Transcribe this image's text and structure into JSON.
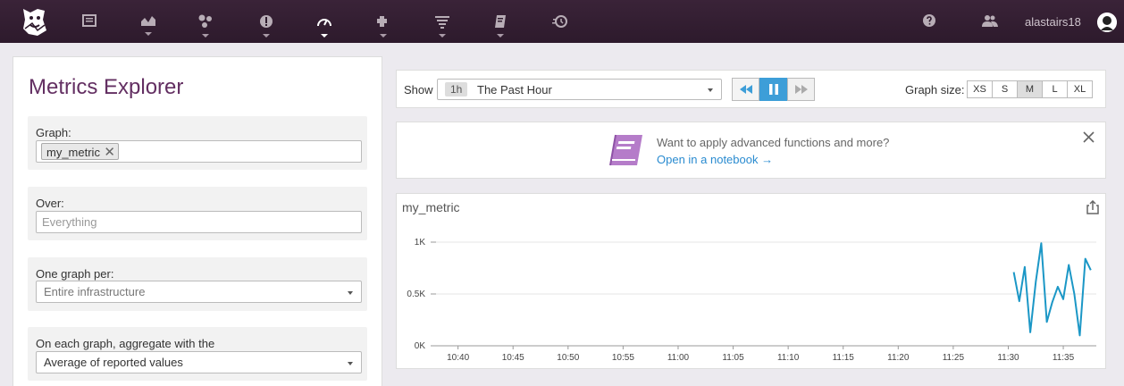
{
  "nav": {
    "icons": [
      "dashboard-icon",
      "metrics-icon",
      "integrations-icon",
      "monitors-icon",
      "apm-icon",
      "infrastructure-icon",
      "logs-icon",
      "notebooks-icon",
      "synthetics-icon"
    ],
    "help_icon": "help-icon",
    "team_icon": "team-icon",
    "username": "alastairs18"
  },
  "left": {
    "title": "Metrics Explorer",
    "graph_label": "Graph:",
    "graph_tag": "my_metric",
    "graph_tag_remove": "✕",
    "over_label": "Over:",
    "over_placeholder": "Everything",
    "per_label": "One graph per:",
    "per_value": "Entire infrastructure",
    "agg_label": "On each graph, aggregate with the",
    "agg_value": "Average of reported values"
  },
  "toolbar": {
    "show_label": "Show",
    "time_badge": "1h",
    "time_text": "The Past Hour",
    "graph_size_label": "Graph size:",
    "sizes": [
      "XS",
      "S",
      "M",
      "L",
      "XL"
    ],
    "active_size": "M"
  },
  "banner": {
    "line1": "Want to apply advanced functions and more?",
    "line2": "Open in a notebook →"
  },
  "colors": {
    "nav_bg": "#2d1a2c",
    "title": "#632f62",
    "accent": "#3d9ed8",
    "line": "#1b97c6",
    "notebook_icon": "#b57cc9"
  },
  "graph": {
    "title": "my_metric"
  },
  "chart_data": {
    "type": "line",
    "title": "my_metric",
    "xlabel": "",
    "ylabel": "",
    "ylim": [
      0,
      1000
    ],
    "yticks": [
      "0K",
      "0.5K",
      "1K"
    ],
    "ytick_values": [
      0,
      500,
      1000
    ],
    "xticks": [
      "10:40",
      "10:45",
      "10:50",
      "10:55",
      "11:00",
      "11:05",
      "11:10",
      "11:15",
      "11:20",
      "11:25",
      "11:30",
      "11:35"
    ],
    "xrange": [
      "10:38",
      "11:38"
    ],
    "grid": true,
    "series": [
      {
        "x": [
          "11:30.5",
          "11:31",
          "11:31.5",
          "11:32",
          "11:32.5",
          "11:33",
          "11:33.5",
          "11:34",
          "11:34.5",
          "11:35",
          "11:35.5",
          "11:36",
          "11:36.5",
          "11:37",
          "11:37.5"
        ],
        "values": [
          710,
          430,
          760,
          130,
          620,
          990,
          230,
          420,
          570,
          450,
          780,
          500,
          100,
          840,
          730
        ]
      }
    ]
  }
}
